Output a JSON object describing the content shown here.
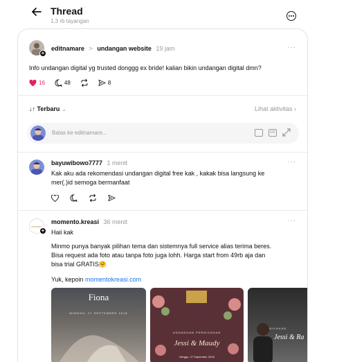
{
  "header": {
    "title": "Thread",
    "subtitle": "1,3 rb tayangan"
  },
  "main_post": {
    "username": "editnamare",
    "separator": ">",
    "community": "undangan website",
    "time": "19 jam",
    "more": "···",
    "text": "Info undangan digital yg trusted donggg ex bride! kalian bikin undangan digital dmn?",
    "likes": "16",
    "comments": "48",
    "shares": "8"
  },
  "sort": {
    "label": "Terbaru",
    "activity_link": "Lihat aktivitas ›"
  },
  "reply_box": {
    "placeholder": "Balas ke editnamare...",
    "gif_label": "GIF"
  },
  "comments": [
    {
      "username": "bayuwibowo7777",
      "time": "1 menit",
      "more": "···",
      "text_line1": "Kak aku ada rekomendasi undangan digital free kak , kakak bisa langsung ke",
      "text_line2": "mer(.)id semoga bermanfaat"
    },
    {
      "username": "momento.kreasi",
      "time": "36 menit",
      "more": "···",
      "text_line1": "Haii kak",
      "para_line1": "Minmo punya banyak pilihan tema dan sistemnya full service alias terima beres.",
      "para_line2": "Bisa request ada foto atau tanpa foto juga lohh. Harga start from 49rb aja dan",
      "para_line3": "bisa trial GRATIS🤗",
      "cta_prefix": "Yuk, kepoin ",
      "cta_link": "momentokreasi.com",
      "media": [
        {
          "name": "Fiona",
          "date": "MINGGU, 27 SEPTEMBER 2018"
        },
        {
          "heading": "UNDANGAN PERNIKAHAN",
          "name": "Jessi & Maudy",
          "date": "Minggu, 27 September 2018"
        },
        {
          "heading": "PERNIKAHAN",
          "name": "Jessi & Ra"
        }
      ]
    }
  ],
  "colors": {
    "heart": "#e0245e",
    "link": "#1a73e8",
    "muted": "#999999"
  }
}
